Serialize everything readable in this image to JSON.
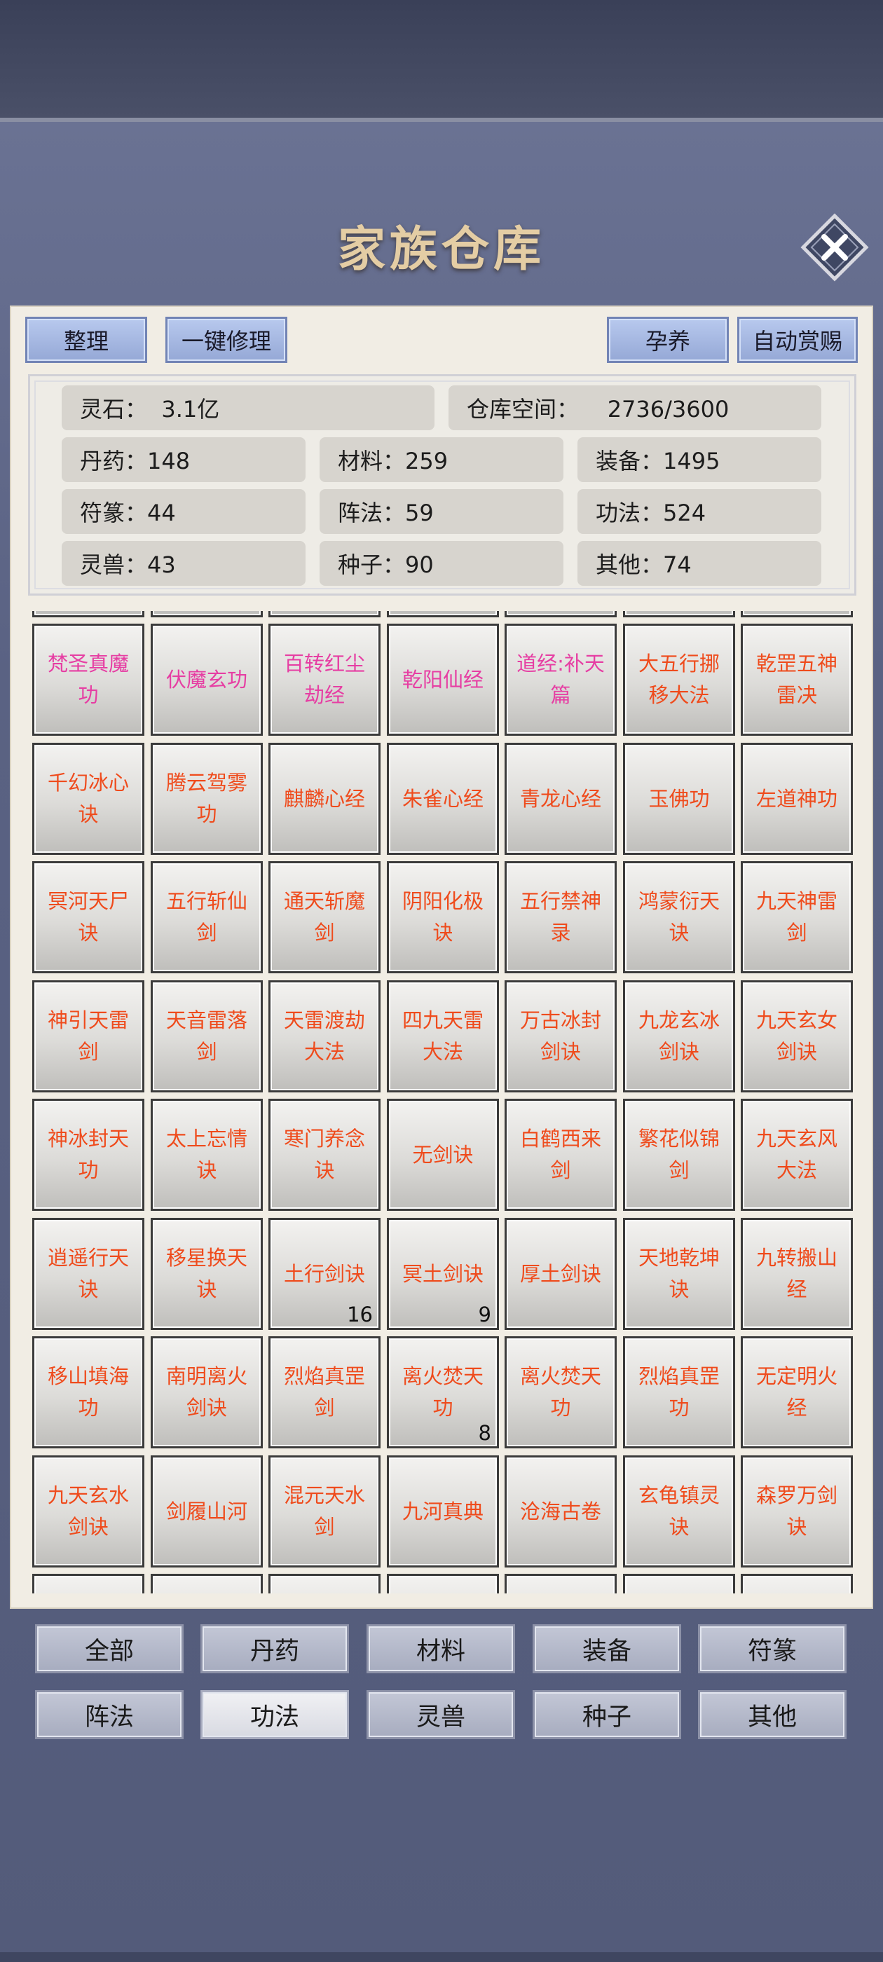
{
  "title": "家族仓库",
  "toolbar": {
    "sort": "整理",
    "repair_all": "一键修理",
    "breed": "孕养",
    "auto_reward": "自动赏赐"
  },
  "stats": {
    "spirit_stone": "灵石：  3.1亿",
    "space": "仓库空间：    2736/3600",
    "pills": "丹药：148",
    "materials": "材料：259",
    "equipment": "装备：1495",
    "talismans": "符篆：44",
    "formations": "阵法：59",
    "techniques": "功法：524",
    "beasts": "灵兽：43",
    "seeds": "种子：90",
    "others": "其他：74"
  },
  "items": [
    [
      "梵圣真魔功",
      "伏魔玄功",
      "百转红尘劫经",
      "乾阳仙经",
      "道经:补天篇",
      "大五行挪移大法",
      "乾罡五神雷决"
    ],
    [
      "千幻冰心诀",
      "腾云驾雾功",
      "麒麟心经",
      "朱雀心经",
      "青龙心经",
      "玉佛功",
      "左道神功"
    ],
    [
      "冥河天尸诀",
      "五行斩仙剑",
      "通天斩魔剑",
      "阴阳化极诀",
      "五行禁神录",
      "鸿蒙衍天诀",
      "九天神雷剑"
    ],
    [
      "神引天雷剑",
      "天音雷落剑",
      "天雷渡劫大法",
      "四九天雷大法",
      "万古冰封剑诀",
      "九龙玄冰剑诀",
      "九天玄女剑诀"
    ],
    [
      "神冰封天功",
      "太上忘情诀",
      "寒门养念诀",
      "无剑诀",
      "白鹤西来剑",
      "繁花似锦剑",
      "九天玄风大法"
    ],
    [
      "逍遥行天诀",
      "移星换天诀",
      "土行剑诀",
      "冥土剑诀",
      "厚土剑诀",
      "天地乾坤诀",
      "九转搬山经"
    ],
    [
      "移山填海功",
      "南明离火剑诀",
      "烈焰真罡剑",
      "离火焚天功",
      "离火焚天功",
      "烈焰真罡功",
      "无定明火经"
    ],
    [
      "九天玄水剑诀",
      "剑履山河",
      "混元天水剑",
      "九河真典",
      "沧海古卷",
      "玄龟镇灵诀",
      "森罗万剑诀"
    ]
  ],
  "item_counts": {
    "5-2": "16",
    "5-3": "9",
    "6-3": "8"
  },
  "pink_items": [
    "0-0",
    "0-1",
    "0-2",
    "0-3",
    "0-4"
  ],
  "categories": [
    "全部",
    "丹药",
    "材料",
    "装备",
    "符篆",
    "阵法",
    "功法",
    "灵兽",
    "种子",
    "其他"
  ],
  "active_category": "功法",
  "colors": {
    "item_text": "#ef4b1c",
    "rare_item_text": "#e63ea3",
    "title": "#e4cda4"
  }
}
